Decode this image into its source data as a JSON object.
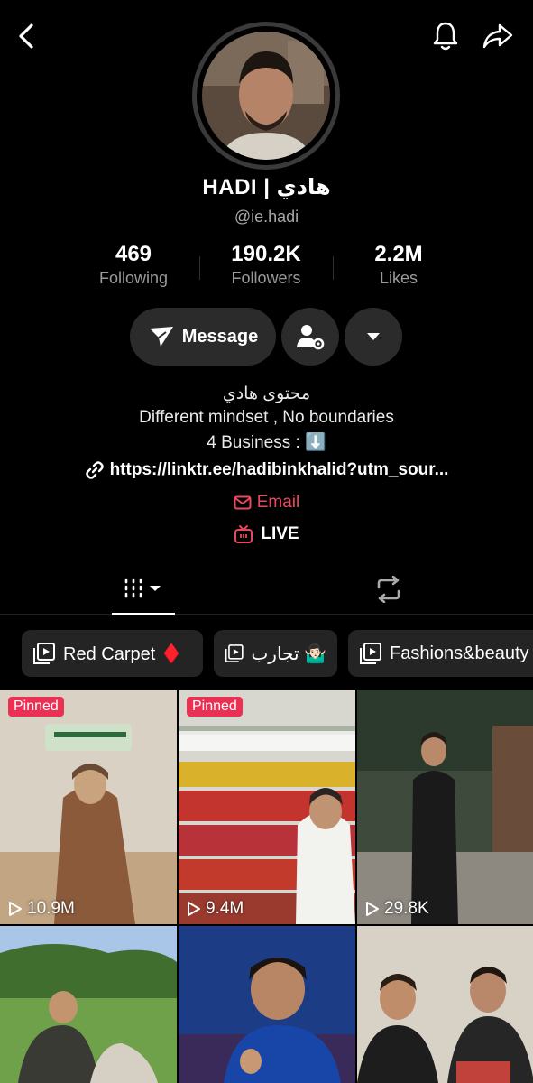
{
  "header": {
    "back_icon": "chevron-left-icon",
    "bell_icon": "bell-icon",
    "share_icon": "share-icon"
  },
  "profile": {
    "name": "HADI | هادي",
    "handle": "@ie.hadi",
    "stats": [
      {
        "value": "469",
        "label": "Following"
      },
      {
        "value": "190.2K",
        "label": "Followers"
      },
      {
        "value": "2.2M",
        "label": "Likes"
      }
    ],
    "message_label": "Message",
    "bio_lines": [
      "محتوى هادي",
      "Different mindset , No boundaries",
      "4 Business : ⬇️"
    ],
    "link": "https://linktr.ee/hadibinkhalid?utm_sour...",
    "email_label": "Email",
    "live_label": "LIVE"
  },
  "collections": [
    {
      "label": "Red Carpet ♦️"
    },
    {
      "label": "تجارب 🤷🏻‍♂️"
    },
    {
      "label": "Fashions&beauty"
    }
  ],
  "videos": [
    {
      "pinned": "Pinned",
      "views": "10.9M"
    },
    {
      "pinned": "Pinned",
      "views": "9.4M"
    },
    {
      "views": "29.8K"
    },
    {},
    {},
    {}
  ],
  "colors": {
    "accent_red": "#ea3154",
    "email_red": "#e64a5c",
    "pill_bg": "#2b2b2b"
  }
}
